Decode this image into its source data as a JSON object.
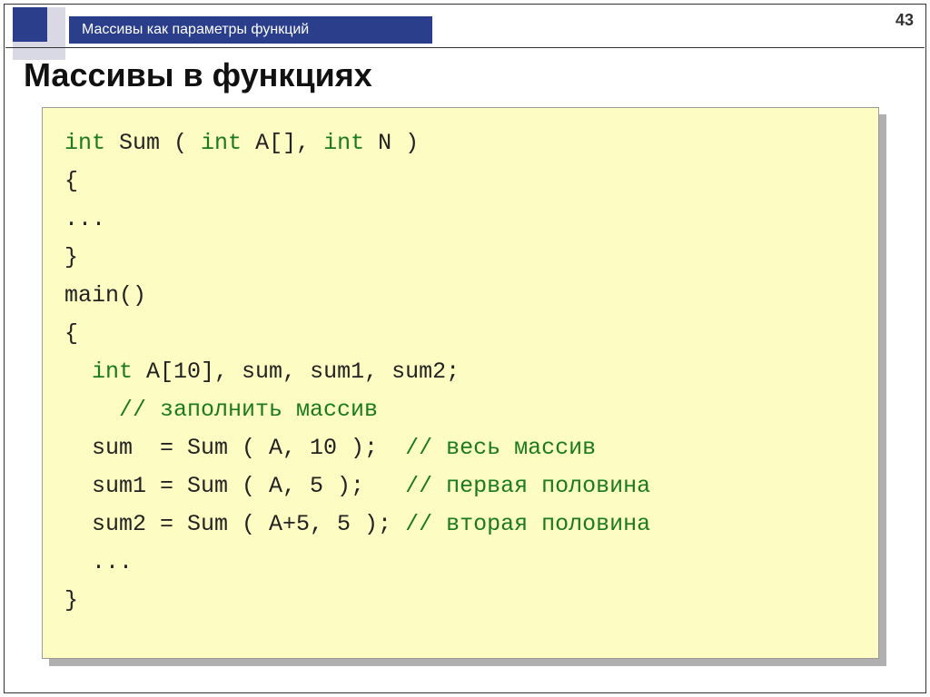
{
  "page_number": "43",
  "header_title": "Массивы как параметры функций",
  "slide_title": "Массивы в функциях",
  "code": {
    "l1a": "int",
    "l1b": " Sum ( ",
    "l1c": "int",
    "l1d": " A[], ",
    "l1e": "int",
    "l1f": " N )",
    "l2": "{",
    "l3": "...",
    "l4": "}",
    "l5": "main()",
    "l6": "{",
    "l7a": "  ",
    "l7b": "int",
    "l7c": " A[10], sum, sum1, sum2;",
    "l8a": "    ",
    "l8b": "// заполнить массив",
    "l9a": "  sum  = Sum ( A, 10 );  ",
    "l9b": "// весь массив",
    "l10a": "  sum1 = Sum ( A, 5 );   ",
    "l10b": "// первая половина",
    "l11a": "  sum2 = Sum ( A+5, 5 ); ",
    "l11b": "// вторая половина",
    "l12": "  ...",
    "l13": "}"
  }
}
